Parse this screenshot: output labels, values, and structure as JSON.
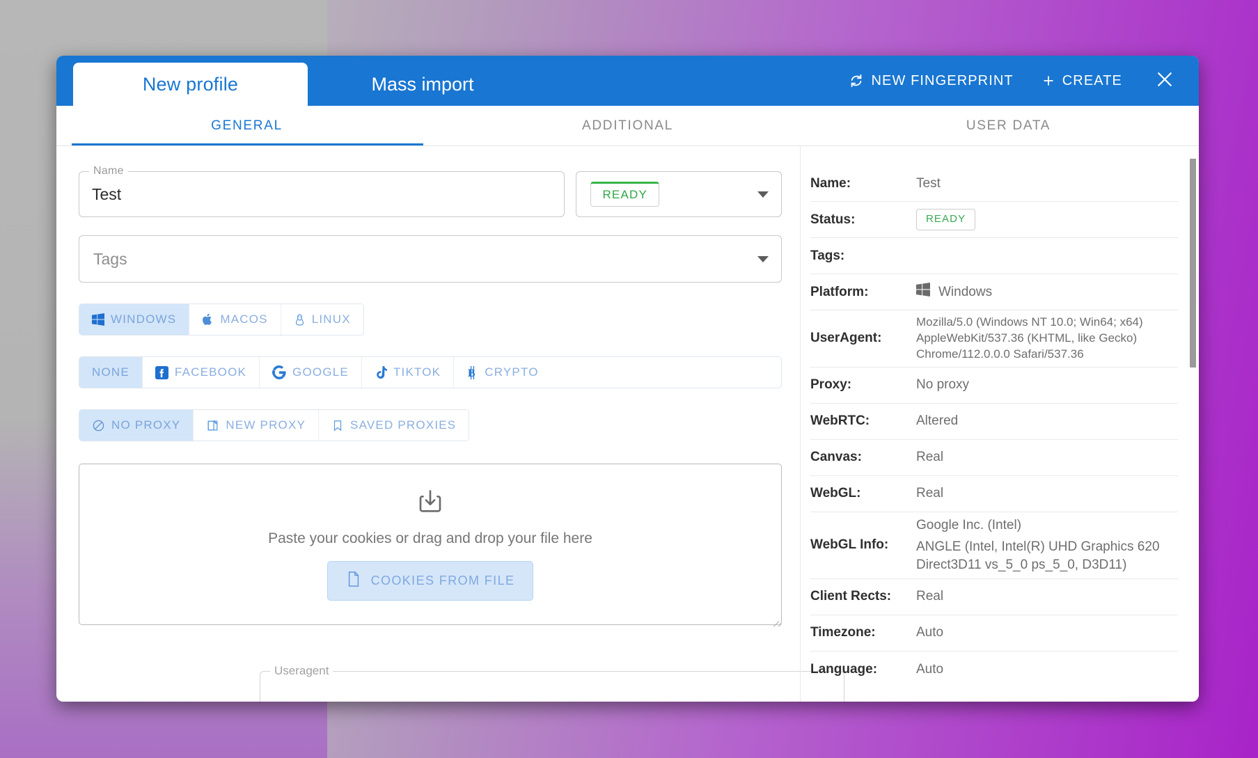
{
  "window": {
    "tabs": [
      {
        "label": "New profile",
        "active": true
      },
      {
        "label": "Mass import",
        "active": false
      }
    ],
    "actions": {
      "new_fingerprint": "NEW FINGERPRINT",
      "create": "CREATE",
      "close": "close-icon"
    },
    "accent_color": "#1976d2"
  },
  "section_tabs": [
    {
      "label": "GENERAL",
      "active": true
    },
    {
      "label": "ADDITIONAL",
      "active": false
    },
    {
      "label": "USER DATA",
      "active": false
    }
  ],
  "form": {
    "name": {
      "legend": "Name",
      "value": "Test"
    },
    "status": {
      "value": "READY",
      "accent": "#36b44a"
    },
    "tags": {
      "placeholder": "Tags"
    },
    "os_group": [
      {
        "label": "WINDOWS",
        "icon": "windows-icon",
        "active": true
      },
      {
        "label": "MACOS",
        "icon": "apple-icon",
        "active": false
      },
      {
        "label": "LINUX",
        "icon": "linux-icon",
        "active": false
      }
    ],
    "preset_group": [
      {
        "label": "NONE",
        "icon": "",
        "active": true
      },
      {
        "label": "FACEBOOK",
        "icon": "facebook-icon",
        "active": false
      },
      {
        "label": "GOOGLE",
        "icon": "google-icon",
        "active": false
      },
      {
        "label": "TIKTOK",
        "icon": "tiktok-icon",
        "active": false
      },
      {
        "label": "CRYPTO",
        "icon": "bitcoin-icon",
        "active": false
      }
    ],
    "proxy_group": [
      {
        "label": "NO PROXY",
        "icon": "no-entry-icon",
        "active": true
      },
      {
        "label": "NEW PROXY",
        "icon": "edit-square-icon",
        "active": false
      },
      {
        "label": "SAVED PROXIES",
        "icon": "bookmark-icon",
        "active": false
      }
    ],
    "dropzone": {
      "icon": "download-box-icon",
      "text": "Paste your cookies or drag and drop your file here",
      "button": "COOKIES FROM FILE",
      "button_icon": "file-icon"
    },
    "useragent_field": {
      "legend": "Useragent",
      "value": ""
    }
  },
  "details": [
    {
      "key": "Name:",
      "value": "Test",
      "type": "text"
    },
    {
      "key": "Status:",
      "value": "READY",
      "type": "badge"
    },
    {
      "key": "Tags:",
      "value": "",
      "type": "text"
    },
    {
      "key": "Platform:",
      "value": "Windows",
      "type": "platform",
      "icon": "windows-icon"
    },
    {
      "key": "UserAgent:",
      "value": "Mozilla/5.0 (Windows NT 10.0; Win64; x64) AppleWebKit/537.36 (KHTML, like Gecko) Chrome/112.0.0.0 Safari/537.36",
      "type": "multiline"
    },
    {
      "key": "Proxy:",
      "value": "No proxy",
      "type": "text"
    },
    {
      "key": "WebRTC:",
      "value": "Altered",
      "type": "text"
    },
    {
      "key": "Canvas:",
      "value": "Real",
      "type": "text"
    },
    {
      "key": "WebGL:",
      "value": "Real",
      "type": "text"
    },
    {
      "key": "WebGL Info:",
      "value": "Google Inc. (Intel)",
      "value2": "ANGLE (Intel, Intel(R) UHD Graphics 620 Direct3D11 vs_5_0 ps_5_0, D3D11)",
      "type": "webgl"
    },
    {
      "key": "Client Rects:",
      "value": "Real",
      "type": "text"
    },
    {
      "key": "Timezone:",
      "value": "Auto",
      "type": "text"
    },
    {
      "key": "Language:",
      "value": "Auto",
      "type": "text"
    }
  ]
}
